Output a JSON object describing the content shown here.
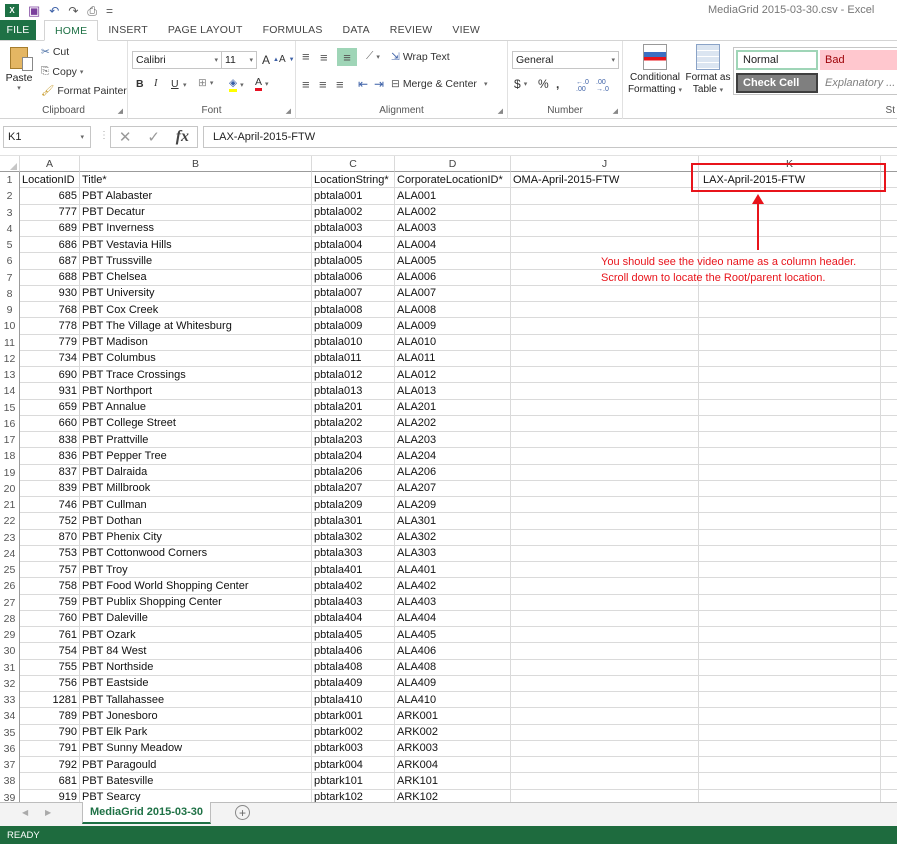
{
  "window": {
    "title": "MediaGrid 2015-03-30.csv - Excel"
  },
  "qat": {
    "excel_logo": "X≣",
    "save_icon": "💾",
    "undo_icon": "↶",
    "redo_icon": "↷",
    "preview_icon": "🔍",
    "customize": "="
  },
  "tabs": [
    {
      "label": "FILE"
    },
    {
      "label": "HOME"
    },
    {
      "label": "INSERT"
    },
    {
      "label": "PAGE LAYOUT"
    },
    {
      "label": "FORMULAS"
    },
    {
      "label": "DATA"
    },
    {
      "label": "REVIEW"
    },
    {
      "label": "VIEW"
    }
  ],
  "ribbon": {
    "clipboard": {
      "label": "Clipboard",
      "paste": "Paste",
      "cut": "Cut",
      "copy": "Copy",
      "format_painter": "Format Painter"
    },
    "font": {
      "label": "Font",
      "font_name": "Calibri",
      "font_size": "11",
      "bold": "B",
      "italic": "I",
      "underline": "U"
    },
    "alignment": {
      "label": "Alignment",
      "wrap_text": "Wrap Text",
      "merge_center": "Merge & Center"
    },
    "number": {
      "label": "Number",
      "format": "General",
      "currency": "$",
      "percent": "%",
      "comma": ",",
      "inc_decimal": "←.0 .00",
      "dec_decimal": ".00 →.0"
    },
    "styles": {
      "label": "St",
      "conditional_formatting": [
        "Conditional",
        "Formatting"
      ],
      "format_as_table": [
        "Format as",
        "Table"
      ],
      "normal": "Normal",
      "bad": "Bad",
      "check_cell": "Check Cell",
      "explanatory": "Explanatory ..."
    }
  },
  "formula_bar": {
    "name_box": "K1",
    "content": "LAX-April-2015-FTW",
    "fx": "fx"
  },
  "columns": [
    {
      "letter": "A"
    },
    {
      "letter": "B"
    },
    {
      "letter": "C"
    },
    {
      "letter": "D"
    },
    {
      "letter": "J"
    },
    {
      "letter": "K"
    }
  ],
  "header_row": {
    "row": "1",
    "A": "LocationID",
    "B": "Title*",
    "C": "LocationString*",
    "D": "CorporateLocationID*",
    "J": "OMA-April-2015-FTW",
    "K": "LAX-April-2015-FTW"
  },
  "rows": [
    {
      "row": "2",
      "id": "685",
      "title": "PBT Alabaster",
      "loc": "pbtala001",
      "corp": "ALA001"
    },
    {
      "row": "3",
      "id": "777",
      "title": "PBT Decatur",
      "loc": "pbtala002",
      "corp": "ALA002"
    },
    {
      "row": "4",
      "id": "689",
      "title": "PBT Inverness",
      "loc": "pbtala003",
      "corp": "ALA003"
    },
    {
      "row": "5",
      "id": "686",
      "title": "PBT Vestavia Hills",
      "loc": "pbtala004",
      "corp": "ALA004"
    },
    {
      "row": "6",
      "id": "687",
      "title": "PBT Trussville",
      "loc": "pbtala005",
      "corp": "ALA005"
    },
    {
      "row": "7",
      "id": "688",
      "title": "PBT Chelsea",
      "loc": "pbtala006",
      "corp": "ALA006"
    },
    {
      "row": "8",
      "id": "930",
      "title": "PBT University",
      "loc": "pbtala007",
      "corp": "ALA007"
    },
    {
      "row": "9",
      "id": "768",
      "title": "PBT Cox Creek",
      "loc": "pbtala008",
      "corp": "ALA008"
    },
    {
      "row": "10",
      "id": "778",
      "title": "PBT The Village at Whitesburg",
      "loc": "pbtala009",
      "corp": "ALA009"
    },
    {
      "row": "11",
      "id": "779",
      "title": "PBT Madison",
      "loc": "pbtala010",
      "corp": "ALA010"
    },
    {
      "row": "12",
      "id": "734",
      "title": "PBT Columbus",
      "loc": "pbtala011",
      "corp": "ALA011"
    },
    {
      "row": "13",
      "id": "690",
      "title": "PBT Trace Crossings",
      "loc": "pbtala012",
      "corp": "ALA012"
    },
    {
      "row": "14",
      "id": "931",
      "title": "PBT Northport",
      "loc": "pbtala013",
      "corp": "ALA013"
    },
    {
      "row": "15",
      "id": "659",
      "title": "PBT Annalue",
      "loc": "pbtala201",
      "corp": "ALA201"
    },
    {
      "row": "16",
      "id": "660",
      "title": "PBT College Street",
      "loc": "pbtala202",
      "corp": "ALA202"
    },
    {
      "row": "17",
      "id": "838",
      "title": "PBT Prattville",
      "loc": "pbtala203",
      "corp": "ALA203"
    },
    {
      "row": "18",
      "id": "836",
      "title": "PBT Pepper Tree",
      "loc": "pbtala204",
      "corp": "ALA204"
    },
    {
      "row": "19",
      "id": "837",
      "title": "PBT Dalraida",
      "loc": "pbtala206",
      "corp": "ALA206"
    },
    {
      "row": "20",
      "id": "839",
      "title": "PBT Millbrook",
      "loc": "pbtala207",
      "corp": "ALA207"
    },
    {
      "row": "21",
      "id": "746",
      "title": "PBT Cullman",
      "loc": "pbtala209",
      "corp": "ALA209"
    },
    {
      "row": "22",
      "id": "752",
      "title": "PBT Dothan",
      "loc": "pbtala301",
      "corp": "ALA301"
    },
    {
      "row": "23",
      "id": "870",
      "title": "PBT Phenix City",
      "loc": "pbtala302",
      "corp": "ALA302"
    },
    {
      "row": "24",
      "id": "753",
      "title": "PBT Cottonwood Corners",
      "loc": "pbtala303",
      "corp": "ALA303"
    },
    {
      "row": "25",
      "id": "757",
      "title": "PBT Troy",
      "loc": "pbtala401",
      "corp": "ALA401"
    },
    {
      "row": "26",
      "id": "758",
      "title": "PBT Food World Shopping Center",
      "loc": "pbtala402",
      "corp": "ALA402"
    },
    {
      "row": "27",
      "id": "759",
      "title": "PBT Publix Shopping Center",
      "loc": "pbtala403",
      "corp": "ALA403"
    },
    {
      "row": "28",
      "id": "760",
      "title": "PBT Daleville",
      "loc": "pbtala404",
      "corp": "ALA404"
    },
    {
      "row": "29",
      "id": "761",
      "title": "PBT Ozark",
      "loc": "pbtala405",
      "corp": "ALA405"
    },
    {
      "row": "30",
      "id": "754",
      "title": "PBT 84 West",
      "loc": "pbtala406",
      "corp": "ALA406"
    },
    {
      "row": "31",
      "id": "755",
      "title": "PBT Northside",
      "loc": "pbtala408",
      "corp": "ALA408"
    },
    {
      "row": "32",
      "id": "756",
      "title": "PBT Eastside",
      "loc": "pbtala409",
      "corp": "ALA409"
    },
    {
      "row": "33",
      "id": "1281",
      "title": "PBT Tallahassee",
      "loc": "pbtala410",
      "corp": "ALA410"
    },
    {
      "row": "34",
      "id": "789",
      "title": "PBT Jonesboro",
      "loc": "pbtark001",
      "corp": "ARK001"
    },
    {
      "row": "35",
      "id": "790",
      "title": "PBT Elk Park",
      "loc": "pbtark002",
      "corp": "ARK002"
    },
    {
      "row": "36",
      "id": "791",
      "title": "PBT Sunny Meadow",
      "loc": "pbtark003",
      "corp": "ARK003"
    },
    {
      "row": "37",
      "id": "792",
      "title": "PBT Paragould",
      "loc": "pbtark004",
      "corp": "ARK004"
    },
    {
      "row": "38",
      "id": "681",
      "title": "PBT Batesville",
      "loc": "pbtark101",
      "corp": "ARK101"
    },
    {
      "row": "39",
      "id": "919",
      "title": "PBT Searcy",
      "loc": "pbtark102",
      "corp": "ARK102"
    }
  ],
  "annotation": {
    "lines": [
      "You should see the video name as a column header.",
      "Scroll down to locate the Root/parent location."
    ]
  },
  "sheet_tabs": [
    {
      "label": "MediaGrid 2015-03-30"
    }
  ],
  "sheet_nav": {
    "prev": "◀",
    "next": "▶",
    "add": "⊕"
  },
  "status": {
    "text": "READY"
  },
  "colors": {
    "excel_green": "#1e7145",
    "status_green": "#1e6b3e",
    "annotation_red": "#e8141b",
    "bad_fill": "#ffc7ce",
    "bad_text": "#9c0006"
  }
}
